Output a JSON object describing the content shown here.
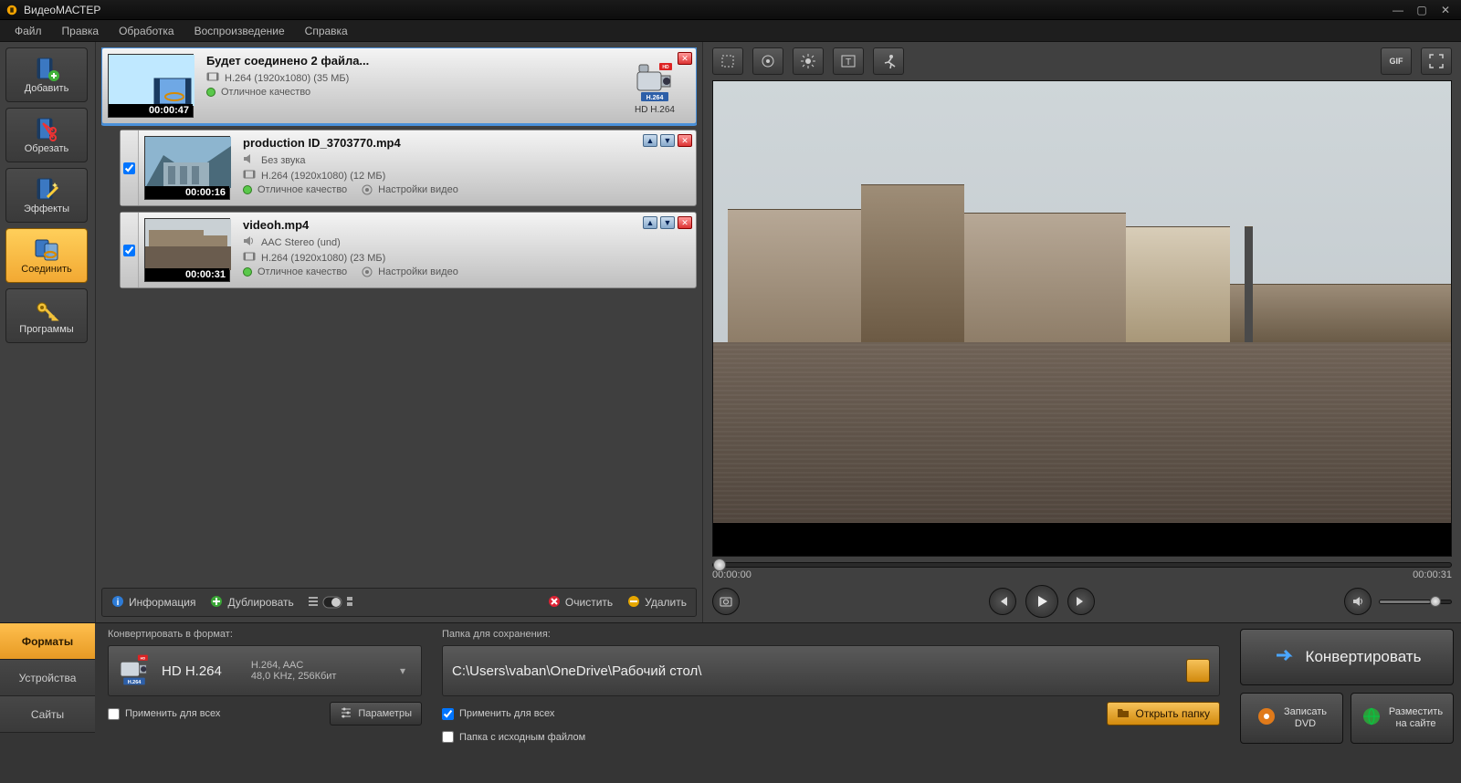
{
  "title": "ВидеоМАСТЕР",
  "menu": {
    "file": "Файл",
    "edit": "Правка",
    "processing": "Обработка",
    "playback": "Воспроизведение",
    "help": "Справка"
  },
  "sidebar": {
    "add": "Добавить",
    "crop": "Обрезать",
    "effects": "Эффекты",
    "join": "Соединить",
    "programs": "Программы"
  },
  "files": [
    {
      "title": "Будет соединено 2 файла...",
      "duration": "00:00:47",
      "audio": "",
      "video": "H.264 (1920x1080) (35 МБ)",
      "quality": "Отличное качество",
      "settings": "",
      "format_caption": "HD H.264",
      "checked": false,
      "selected": true,
      "hasCheck": false,
      "hasCam": true
    },
    {
      "title": "production ID_3703770.mp4",
      "duration": "00:00:16",
      "audio": "Без звука",
      "video": "H.264 (1920x1080) (12 МБ)",
      "quality": "Отличное качество",
      "settings": "Настройки видео",
      "format_caption": "",
      "checked": true,
      "selected": false,
      "hasCheck": true,
      "hasCam": false
    },
    {
      "title": "videoh.mp4",
      "duration": "00:00:31",
      "audio": "AAC Stereo (und)",
      "video": "H.264 (1920x1080) (23 МБ)",
      "quality": "Отличное качество",
      "settings": "Настройки видео",
      "format_caption": "",
      "checked": true,
      "selected": false,
      "hasCheck": true,
      "hasCam": false
    }
  ],
  "list_bar": {
    "info": "Информация",
    "duplicate": "Дублировать",
    "clear": "Очистить",
    "delete": "Удалить"
  },
  "player": {
    "current": "00:00:00",
    "total": "00:00:31"
  },
  "bottom": {
    "tabs": {
      "formats": "Форматы",
      "devices": "Устройства",
      "sites": "Сайты"
    },
    "format_head": "Конвертировать в формат:",
    "format_name": "HD H.264",
    "format_sub1": "H.264, AAC",
    "format_sub2": "48,0 KHz, 256Кбит",
    "apply_all": "Применить для всех",
    "params": "Параметры",
    "save_head": "Папка для сохранения:",
    "path": "C:\\Users\\vaban\\OneDrive\\Рабочий стол\\",
    "apply_all2": "Применить для всех",
    "source_folder": "Папка с исходным файлом",
    "open_folder": "Открыть папку",
    "convert": "Конвертировать",
    "burn_dvd1": "Записать",
    "burn_dvd2": "DVD",
    "publish1": "Разместить",
    "publish2": "на сайте"
  },
  "preview_toolbar": {
    "gif": "GIF"
  }
}
